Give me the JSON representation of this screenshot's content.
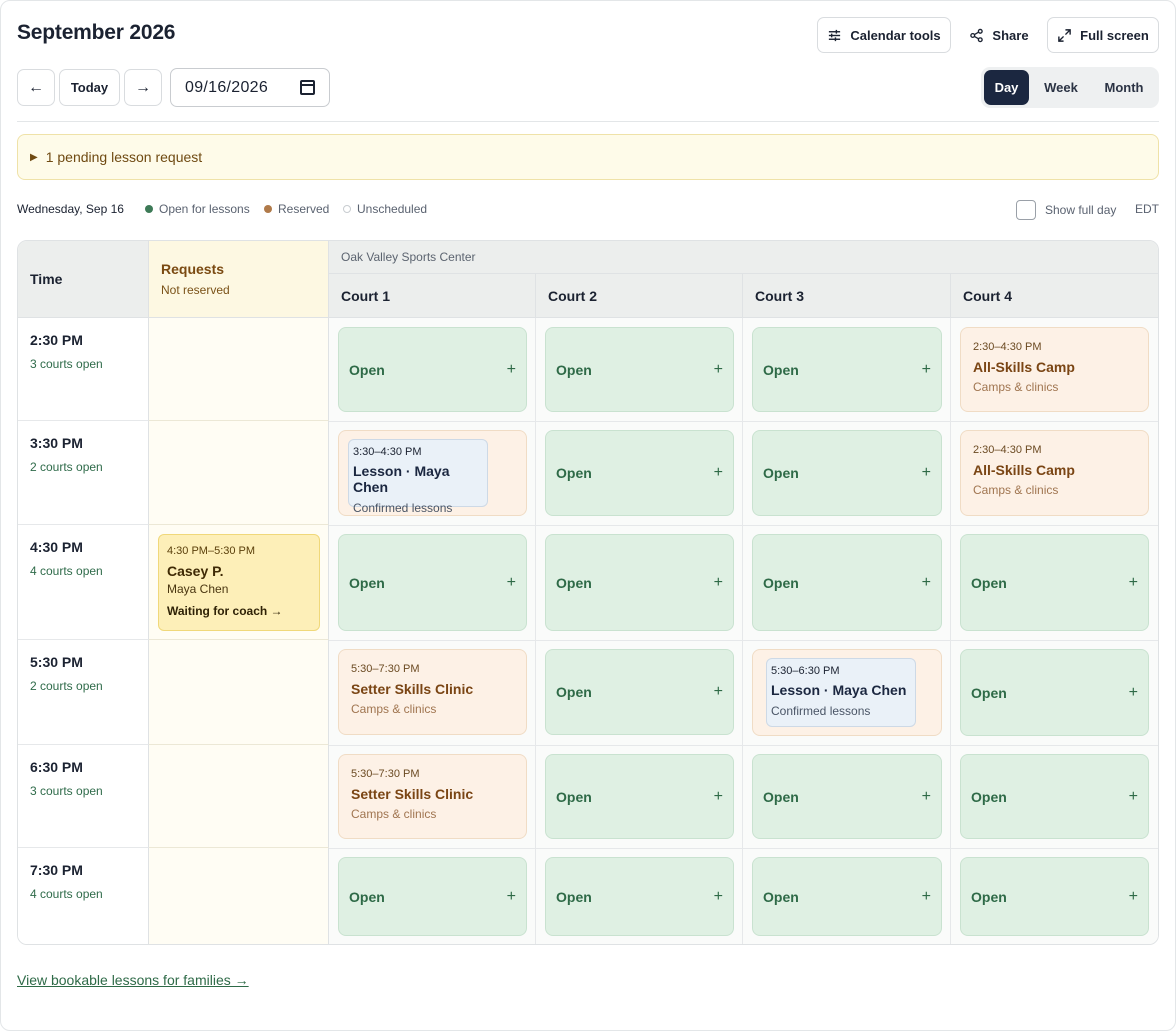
{
  "header": {
    "title": "September 2026",
    "calendar_tools_label": "Calendar tools",
    "share_label": "Share",
    "fullscreen_label": "Full screen"
  },
  "nav": {
    "prev_symbol": "←",
    "today_label": "Today",
    "next_symbol": "→",
    "date_value": "09/16/2026"
  },
  "view_modes": [
    {
      "label": "Day",
      "active": true
    },
    {
      "label": "Week",
      "active": false
    },
    {
      "label": "Month",
      "active": false
    }
  ],
  "pending": {
    "text": "1 pending lesson request"
  },
  "legend": {
    "date": "Wednesday, Sep 16",
    "items": [
      {
        "label": "Open for lessons",
        "color": "#3d7a57"
      },
      {
        "label": "Reserved",
        "color": "#b07a4a"
      },
      {
        "label": "Unscheduled",
        "color": "#ffffff"
      }
    ],
    "show_full_day_label": "Show full day",
    "timezone": "EDT"
  },
  "grid": {
    "time_header": "Time",
    "requests_header": "Requests",
    "requests_subheader": "Not reserved",
    "venue": "Oak Valley Sports Center",
    "courts": [
      "Court 1",
      "Court 2",
      "Court 3",
      "Court 4"
    ],
    "open_label": "Open",
    "plus_symbol": "+",
    "rows": [
      {
        "time": "2:30 PM",
        "open_count": "3 courts open"
      },
      {
        "time": "3:30 PM",
        "open_count": "2 courts open"
      },
      {
        "time": "4:30 PM",
        "open_count": "4 courts open"
      },
      {
        "time": "5:30 PM",
        "open_count": "2 courts open"
      },
      {
        "time": "6:30 PM",
        "open_count": "3 courts open"
      },
      {
        "time": "7:30 PM",
        "open_count": "4 courts open"
      }
    ],
    "events": {
      "camp_1": {
        "time": "2:30–4:30 PM",
        "name": "All-Skills Camp",
        "category": "Camps & clinics"
      },
      "camp_2": {
        "time": "2:30–4:30 PM",
        "name": "All-Skills Camp",
        "category": "Camps & clinics"
      },
      "lesson_1": {
        "time": "3:30–4:30 PM",
        "name": "Lesson · Maya Chen",
        "category": "Confirmed lessons"
      },
      "request_1": {
        "time": "4:30 PM–5:30 PM",
        "name": "Casey P.",
        "coach": "Maya Chen",
        "status": "Waiting for coach →"
      },
      "clinic_1": {
        "time": "5:30–7:30 PM",
        "name": "Setter Skills Clinic",
        "category": "Camps & clinics"
      },
      "clinic_2": {
        "time": "5:30–7:30 PM",
        "name": "Setter Skills Clinic",
        "category": "Camps & clinics"
      },
      "lesson_2": {
        "time": "5:30–6:30 PM",
        "name": "Lesson · Maya Chen",
        "category": "Confirmed lessons"
      }
    }
  },
  "footer": {
    "link_label": "View bookable lessons for families →"
  }
}
